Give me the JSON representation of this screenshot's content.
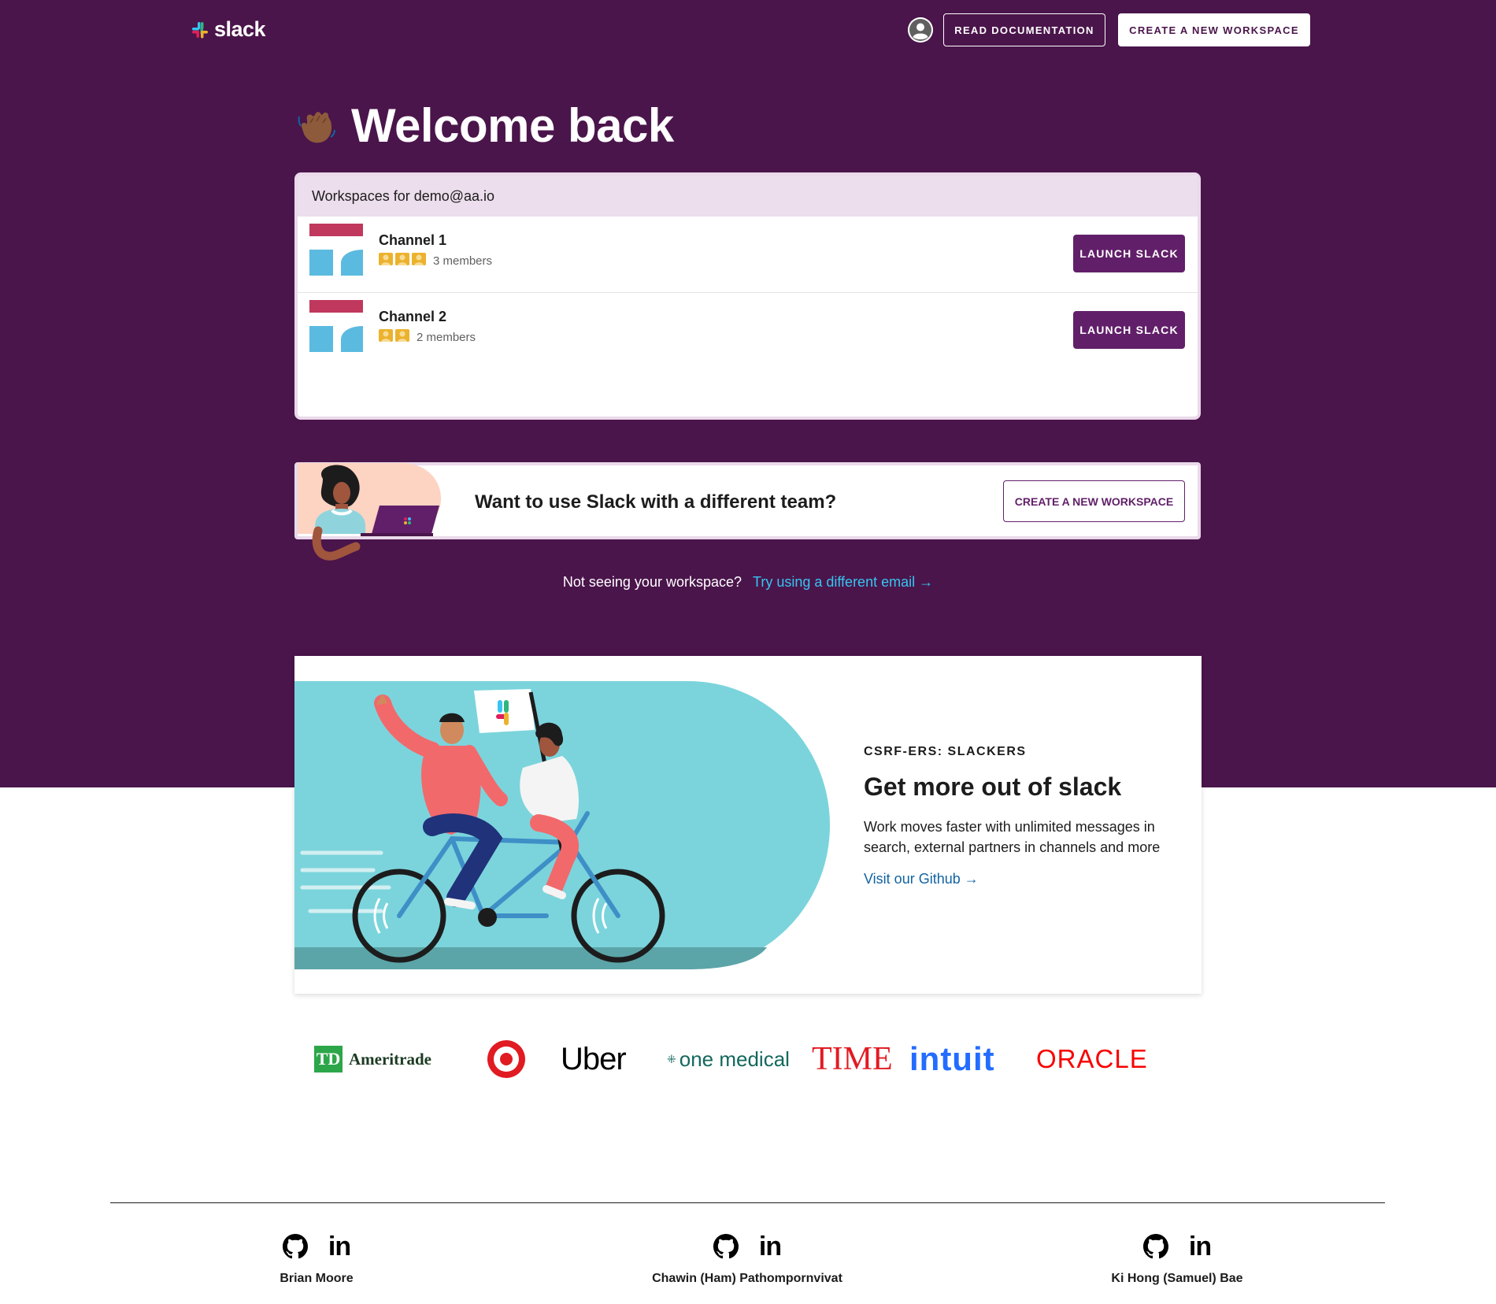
{
  "header": {
    "logo_text": "slack",
    "avatar_icon": "user-avatar-icon",
    "read_docs_label": "READ DOCUMENTATION",
    "create_workspace_label": "CREATE A NEW WORKSPACE"
  },
  "welcome": {
    "emoji_icon": "waving-hand-icon",
    "title": "Welcome back"
  },
  "workspaces": {
    "header": "Workspaces for demo@aa.io",
    "items": [
      {
        "name": "Channel 1",
        "member_count": 3,
        "members_label": "3 members",
        "action_label": "LAUNCH SLACK"
      },
      {
        "name": "Channel 2",
        "member_count": 2,
        "members_label": "2 members",
        "action_label": "LAUNCH SLACK"
      }
    ]
  },
  "different_team": {
    "text": "Want to use Slack with a different team?",
    "button_label": "CREATE A NEW WORKSPACE"
  },
  "not_seeing": {
    "text": "Not seeing your workspace?",
    "link": "Try using a different email →"
  },
  "promo": {
    "eyebrow": "CSRF-ERS: SLACKERS",
    "title": "Get more out of slack",
    "body": "Work moves faster with unlimited messages in search, external partners in channels and more",
    "link": "Visit our Github →"
  },
  "customer_logos": {
    "td_badge": "TD",
    "td_name": "Ameritrade",
    "target_icon": "target-logo-icon",
    "uber": "Uber",
    "one_medical": "one medical",
    "time": "TIME",
    "intuit": "intuit",
    "oracle": "ORACLE"
  },
  "team": [
    {
      "name": "Brian Moore"
    },
    {
      "name": "Chawin (Ham) Pathompornvivat"
    },
    {
      "name": "Ki Hong (Samuel) Bae"
    }
  ],
  "linkedin_label": "in",
  "colors": {
    "brand_purple": "#4a154b",
    "button_purple": "#611f69",
    "link_blue": "#1264a3",
    "link_cyan": "#36c5f0",
    "slack_blue": "#36c5f0",
    "slack_green": "#2eb67d",
    "slack_yellow": "#ecb22e",
    "slack_red": "#e01e5a"
  }
}
